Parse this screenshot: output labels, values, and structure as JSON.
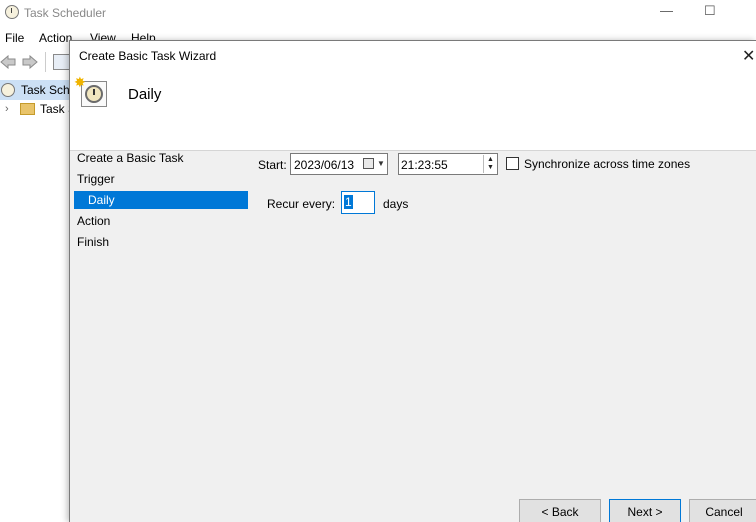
{
  "main_window": {
    "title": "Task Scheduler",
    "min_symbol": "—",
    "max_symbol": "☐",
    "menu": {
      "file": "File",
      "action": "Action",
      "view": "View",
      "help": "Help"
    },
    "tree": {
      "root_label": "Task Sche",
      "child_label": "Task S",
      "expand_glyph": "›"
    }
  },
  "wizard": {
    "title": "Create Basic Task Wizard",
    "close_symbol": "✕",
    "header_title": "Daily",
    "star_glyph": "✸",
    "steps": {
      "create": "Create a Basic Task",
      "trigger": "Trigger",
      "daily": "Daily",
      "action": "Action",
      "finish": "Finish"
    },
    "form": {
      "start_label": "Start:",
      "date_value": "2023/06/13",
      "time_value": "21:23:55",
      "sync_label": "Synchronize across time zones",
      "sync_checked": false,
      "recur_label": "Recur every:",
      "recur_value": "1",
      "recur_unit": "days"
    },
    "buttons": {
      "back": "< Back",
      "next": "Next >",
      "cancel": "Cancel"
    },
    "accent_color": "#0078d7"
  }
}
